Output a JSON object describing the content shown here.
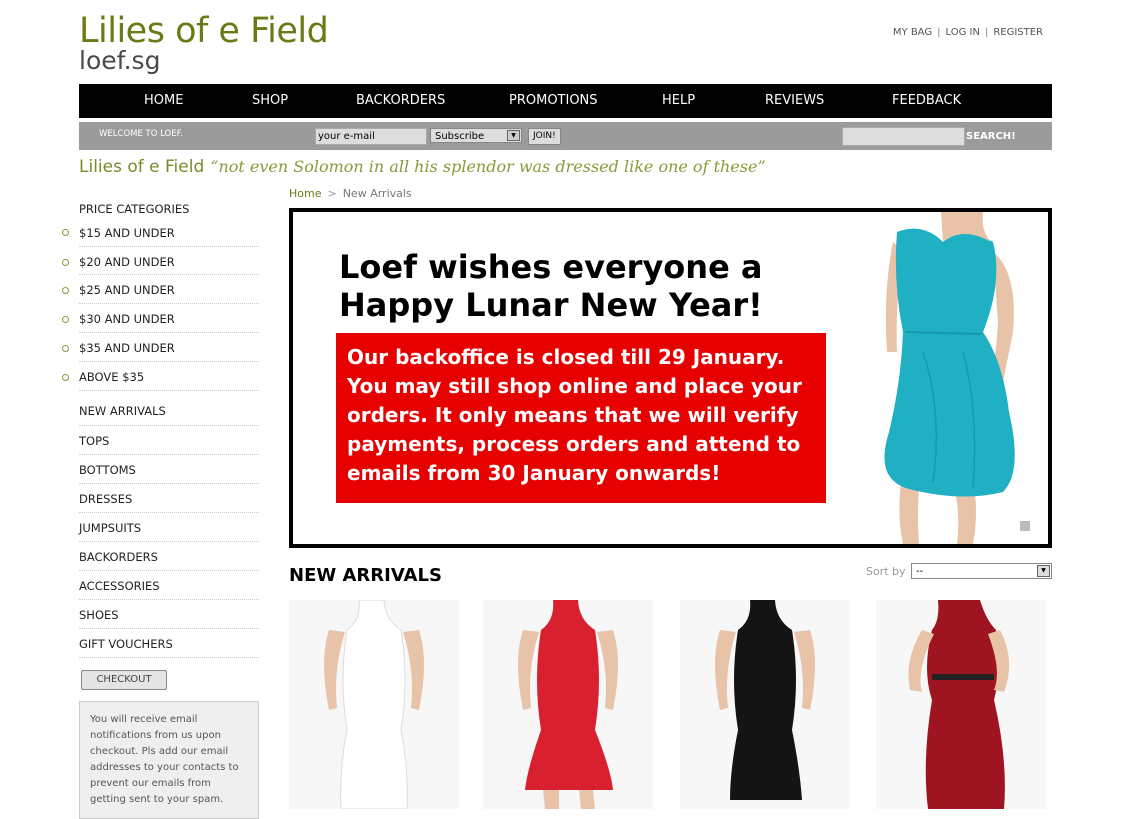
{
  "logo": {
    "line1": "Lilies of e Field",
    "line2": "loef.sg"
  },
  "top_links": [
    "MY BAG",
    "LOG IN",
    "REGISTER"
  ],
  "nav": [
    "HOME",
    "SHOP",
    "BACKORDERS",
    "PROMOTIONS",
    "HELP",
    "REVIEWS",
    "FEEDBACK"
  ],
  "subbar": {
    "welcome": "WELCOME TO LOEF.",
    "email_value": "your e-mail",
    "subscribe_option": "Subscribe",
    "join_label": "JOIN!",
    "search_label": "SEARCH!"
  },
  "tagline": {
    "brand": "Lilies of e Field",
    "quote": "“not even Solomon in all his splendor was dressed like one of these”"
  },
  "breadcrumb": {
    "home": "Home",
    "sep": ">",
    "current": "New Arrivals"
  },
  "sidebar": {
    "price_heading": "PRICE CATEGORIES",
    "price_items": [
      "$15 AND UNDER",
      "$20 AND UNDER",
      "$25 AND UNDER",
      "$30 AND UNDER",
      "$35 AND UNDER",
      "ABOVE $35"
    ],
    "categories": [
      "NEW ARRIVALS",
      "TOPS",
      "BOTTOMS",
      "DRESSES",
      "JUMPSUITS",
      "BACKORDERS",
      "ACCESSORIES",
      "SHOES",
      "GIFT VOUCHERS"
    ],
    "checkout_label": "CHECKOUT",
    "note": "You will receive email notifications from us upon checkout. Pls add our email addresses to your contacts to prevent our emails from getting sent to your spam."
  },
  "banner": {
    "headline_1": "Loef wishes everyone a",
    "headline_2": "Happy Lunar New Year!",
    "notice_lines": [
      "Our backoffice is closed till 29 January.",
      "You may still shop online and place your",
      "orders. It only means that we will verify",
      "payments, process orders and attend to",
      "emails from 30 January onwards!"
    ]
  },
  "new_arrivals": {
    "title": "NEW ARRIVALS",
    "sort_label": "Sort by",
    "sort_value": "--",
    "products": [
      {
        "name": "white lace halter dress",
        "color": "#f4f4f4"
      },
      {
        "name": "red lace halter dress",
        "color": "#d8202f"
      },
      {
        "name": "black lace halter dress",
        "color": "#141414"
      },
      {
        "name": "maroon draped maxi dress",
        "color": "#9e1420"
      }
    ]
  },
  "colors": {
    "brand_green": "#6b7a16",
    "nav_bg": "#000000",
    "subbar_bg": "#9b9b9b",
    "banner_red": "#e60000",
    "dress_teal": "#1fb1c3"
  }
}
